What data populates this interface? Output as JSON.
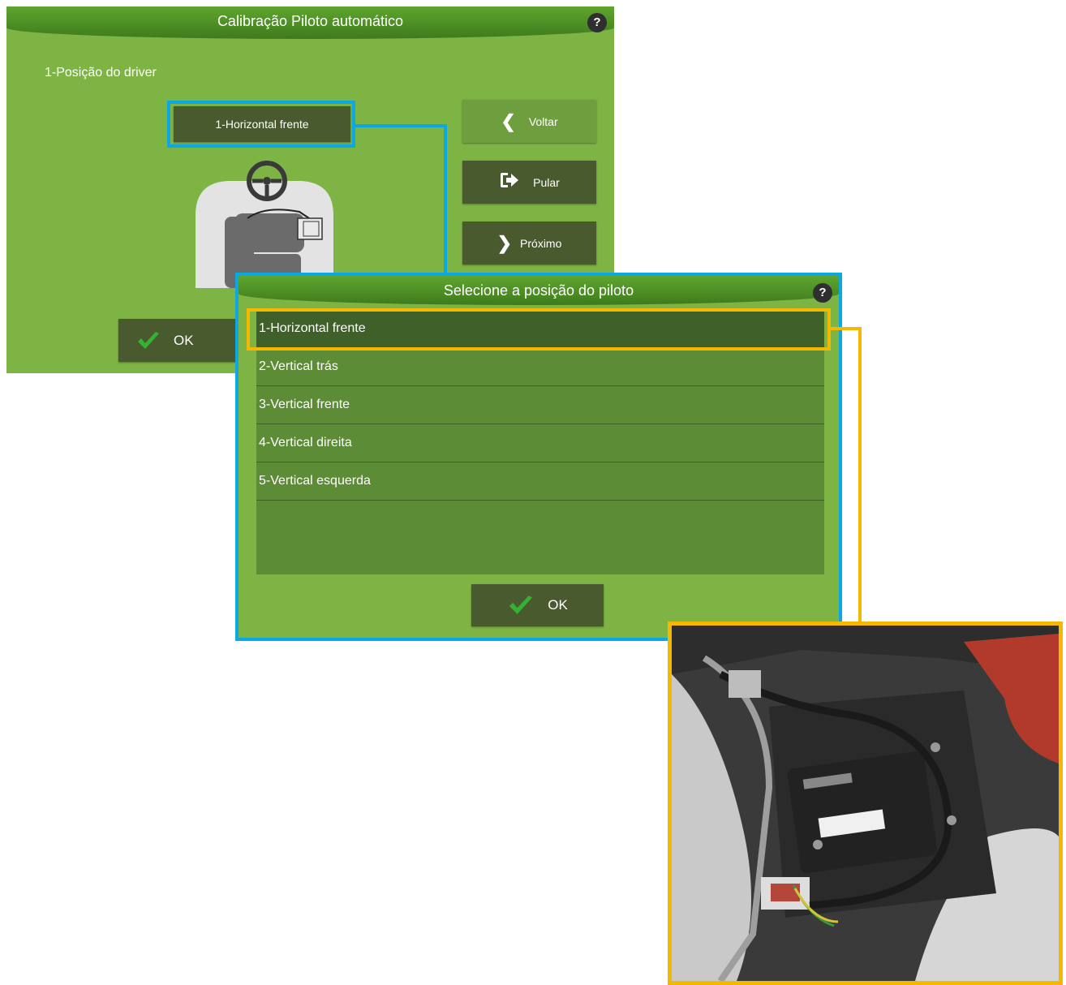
{
  "calibration": {
    "title": "Calibração Piloto automático",
    "help": "?",
    "section_label": "1-Posição do driver",
    "position_value": "1-Horizontal frente",
    "buttons": {
      "back": "Voltar",
      "skip": "Pular",
      "next": "Próximo",
      "ok": "OK"
    }
  },
  "dialog": {
    "title": "Selecione a posição do piloto",
    "help": "?",
    "options": [
      "1-Horizontal frente",
      "2-Vertical trás",
      "3-Vertical frente",
      "4-Vertical direita",
      "5-Vertical esquerda"
    ],
    "selected_index": 0,
    "ok": "OK"
  },
  "colors": {
    "panel_green": "#7db443",
    "title_green": "#4a8a22",
    "button_dark": "#4a5a2f",
    "highlight_blue": "#0aa9e6",
    "highlight_yellow": "#f5b800"
  }
}
